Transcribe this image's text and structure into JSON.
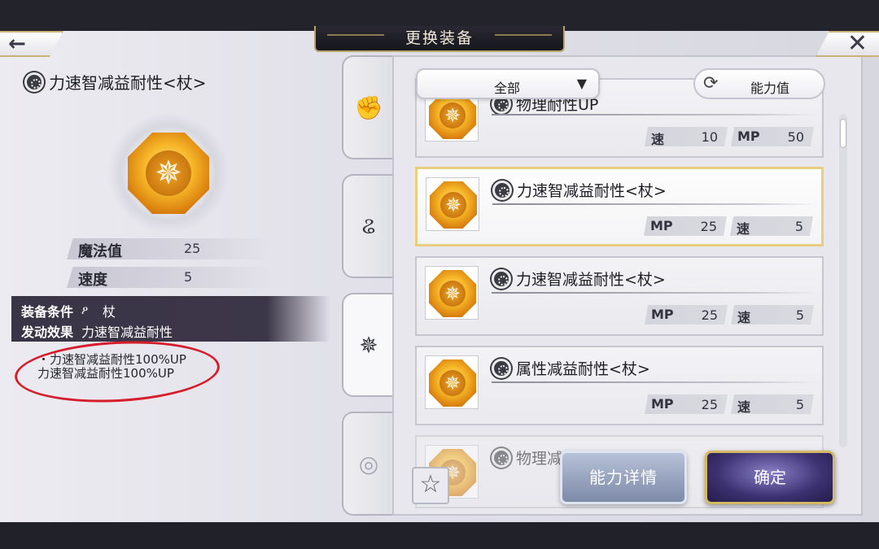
{
  "header": {
    "title": "更换装备",
    "back_icon": "←",
    "close_icon": "✕"
  },
  "detail": {
    "item_name": "力速智减益耐性<杖>",
    "stats": [
      {
        "label": "魔法值",
        "value": "25"
      },
      {
        "label": "速度",
        "value": "5"
      }
    ],
    "condition_label": "装备条件",
    "condition_value": "杖",
    "effect_label": "发动效果",
    "effect_value": "力速智减益耐性",
    "effect_lines": [
      "・力速智减益耐性100%UP",
      "力速智减益耐性100%UP"
    ]
  },
  "tabs": [
    {
      "icon": "fist-icon",
      "glyph": "✊"
    },
    {
      "icon": "swirl-icon",
      "glyph": "ଌ"
    },
    {
      "icon": "gear-emblem-icon",
      "glyph": "✵"
    },
    {
      "icon": "wave-icon",
      "glyph": "◎"
    }
  ],
  "toolbar": {
    "filter_label": "全部",
    "filter_arrow": "▼",
    "sort_icon": "⟳",
    "sort_label": "能力值"
  },
  "cards": [
    {
      "title": "物理耐性UP",
      "stats": [
        {
          "k": "速",
          "v": "10"
        },
        {
          "k": "MP",
          "v": "50"
        }
      ]
    },
    {
      "title": "力速智减益耐性<杖>",
      "stats": [
        {
          "k": "MP",
          "v": "25"
        },
        {
          "k": "速",
          "v": "5"
        }
      ]
    },
    {
      "title": "力速智减益耐性<杖>",
      "stats": [
        {
          "k": "MP",
          "v": "25"
        },
        {
          "k": "速",
          "v": "5"
        }
      ]
    },
    {
      "title": "属性减益耐性<杖>",
      "stats": [
        {
          "k": "MP",
          "v": "25"
        },
        {
          "k": "速",
          "v": "5"
        }
      ]
    },
    {
      "title": "物理减",
      "stats": []
    }
  ],
  "actions": {
    "favorite_icon": "☆",
    "detail_label": "能力详情",
    "confirm_label": "确定"
  },
  "colors": {
    "accent_gold": "#d4b863",
    "annotation_red": "#d61d2b",
    "confirm_purple": "#3b3170"
  }
}
